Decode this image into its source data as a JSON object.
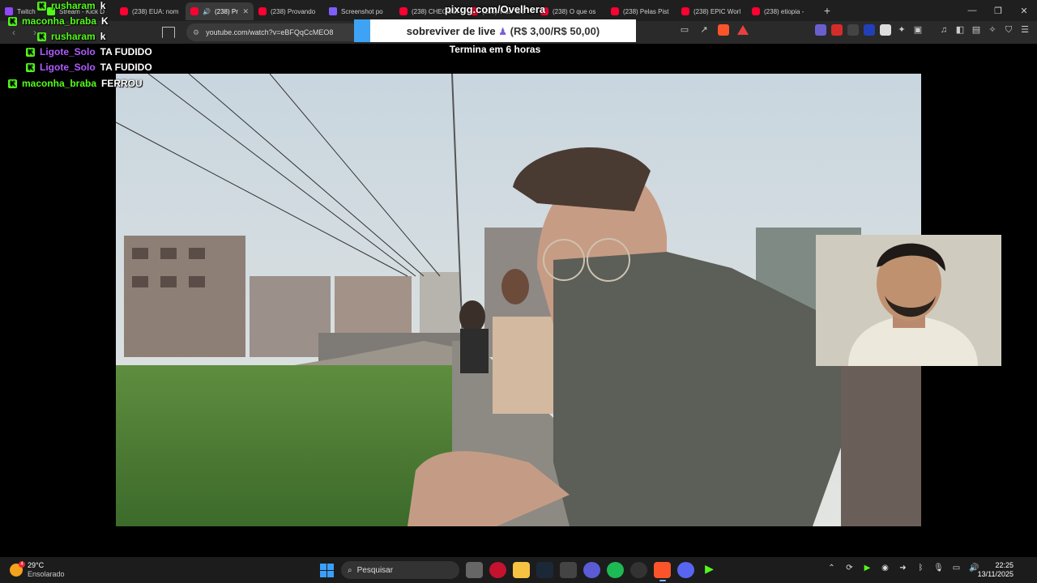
{
  "browser": {
    "tabs": [
      {
        "label": "Twitch",
        "icon": "twitch-icon",
        "active": false
      },
      {
        "label": "Stream - Kick D",
        "icon": "kick-icon",
        "active": false
      },
      {
        "label": "(238) EUA: nom",
        "icon": "youtube-icon",
        "active": false
      },
      {
        "label": "(238) Pr",
        "icon": "youtube-icon",
        "active": true
      },
      {
        "label": "(238) Provando",
        "icon": "youtube-icon",
        "active": false
      },
      {
        "label": "Screenshot po",
        "icon": "screenshot-icon",
        "active": false
      },
      {
        "label": "(238) CHEGUEI",
        "icon": "youtube-icon",
        "active": false
      },
      {
        "label": "(238) Vida \"EO",
        "icon": "youtube-icon",
        "active": false
      },
      {
        "label": "(238) O que os",
        "icon": "youtube-icon",
        "active": false
      },
      {
        "label": "(238) Pelas Pist",
        "icon": "youtube-icon",
        "active": false
      },
      {
        "label": "(238) EPIC Worl",
        "icon": "youtube-icon",
        "active": false
      },
      {
        "label": "(238) etiopia -",
        "icon": "youtube-icon",
        "active": false
      }
    ],
    "new_tab": "+",
    "window_controls": {
      "minimize": "—",
      "restore": "❐",
      "close": "✕"
    },
    "address": "youtube.com/watch?v=eBFQqCcMEO8"
  },
  "overlay": {
    "pix_title": "pixgg.com/Ovelhera",
    "donation_text": "sobreviver de live",
    "donation_price": "(R$ 3,00/R$ 50,00)",
    "countdown": "Termina em 6 horas"
  },
  "chat": [
    {
      "user": "rusharam",
      "message": "k",
      "color": "green"
    },
    {
      "user": "maconha_braba",
      "message": "K",
      "color": "green"
    },
    {
      "user": "rusharam",
      "message": "k",
      "color": "green"
    },
    {
      "user": "Ligote_Solo",
      "message": "TA FUDIDO",
      "color": "purple"
    },
    {
      "user": "Ligote_Solo",
      "message": "TA FUDIDO",
      "color": "purple"
    },
    {
      "user": "maconha_braba",
      "message": "FERROU",
      "color": "green"
    }
  ],
  "taskbar": {
    "weather_temp": "29°C",
    "weather_condition": "Ensolarado",
    "weather_badge": "4",
    "search_placeholder": "Pesquisar",
    "time": "22:25",
    "date": "13/11/2025"
  }
}
